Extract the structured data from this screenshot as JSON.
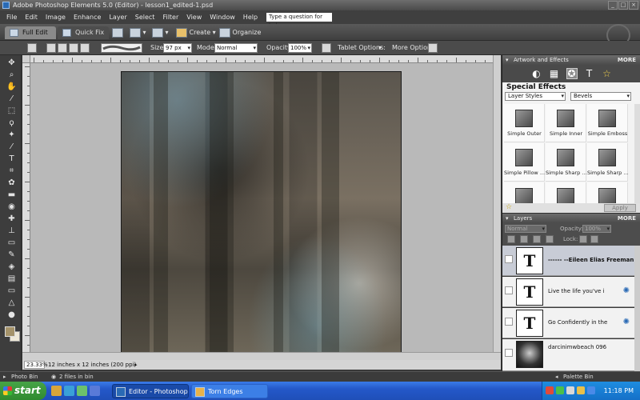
{
  "window": {
    "title": "Adobe Photoshop Elements 5.0 (Editor) - lesson1_edited-1.psd"
  },
  "menu": {
    "items": [
      "File",
      "Edit",
      "Image",
      "Enhance",
      "Layer",
      "Select",
      "Filter",
      "View",
      "Window",
      "Help"
    ],
    "help_placeholder": "Type a question for help"
  },
  "modebar": {
    "full_edit": "Full Edit",
    "quick_fix": "Quick Fix",
    "create": "Create",
    "organize": "Organize"
  },
  "options": {
    "size_label": "Size:",
    "size_value": "97 px",
    "mode_label": "Mode:",
    "mode_value": "Normal",
    "opacity_label": "Opacity:",
    "opacity_value": "100%",
    "tablet_label": "Tablet Options:",
    "more_label": "More Options:"
  },
  "status": {
    "zoom": "23.33%",
    "docinfo": "12 inches x 12 inches (200 ppi)"
  },
  "palette": {
    "artwork_header": "Artwork and Effects",
    "more": "MORE",
    "special_effects": "Special Effects",
    "category_select": "Layer Styles",
    "style_select": "Bevels",
    "styles": [
      "Simple Outer",
      "Simple Inner",
      "Simple Emboss",
      "Simple Pillow ...",
      "Simple Sharp ...",
      "Simple Sharp ..."
    ],
    "apply": "Apply",
    "layers_header": "Layers",
    "layer_mode": "Normal",
    "opacity_label": "Opacity:",
    "opacity_value": "100%",
    "lock_label": "Lock:",
    "layers": [
      {
        "name": "------ --Eileen Elias Freeman",
        "thumb": "T"
      },
      {
        "name": "Live the life        you've i",
        "thumb": "T"
      },
      {
        "name": "Go Confidently in        the",
        "thumb": "T"
      },
      {
        "name": "darcinimwbeach 096",
        "thumb": ""
      }
    ]
  },
  "bins": {
    "photo_bin": "Photo Bin",
    "files_in_bin": "2 files in bin",
    "palette_bin": "Palette Bin"
  },
  "taskbar": {
    "start": "start",
    "task1": "Editor - Photoshop El...",
    "task2": "Torn Edges",
    "clock": "11:18 PM"
  }
}
